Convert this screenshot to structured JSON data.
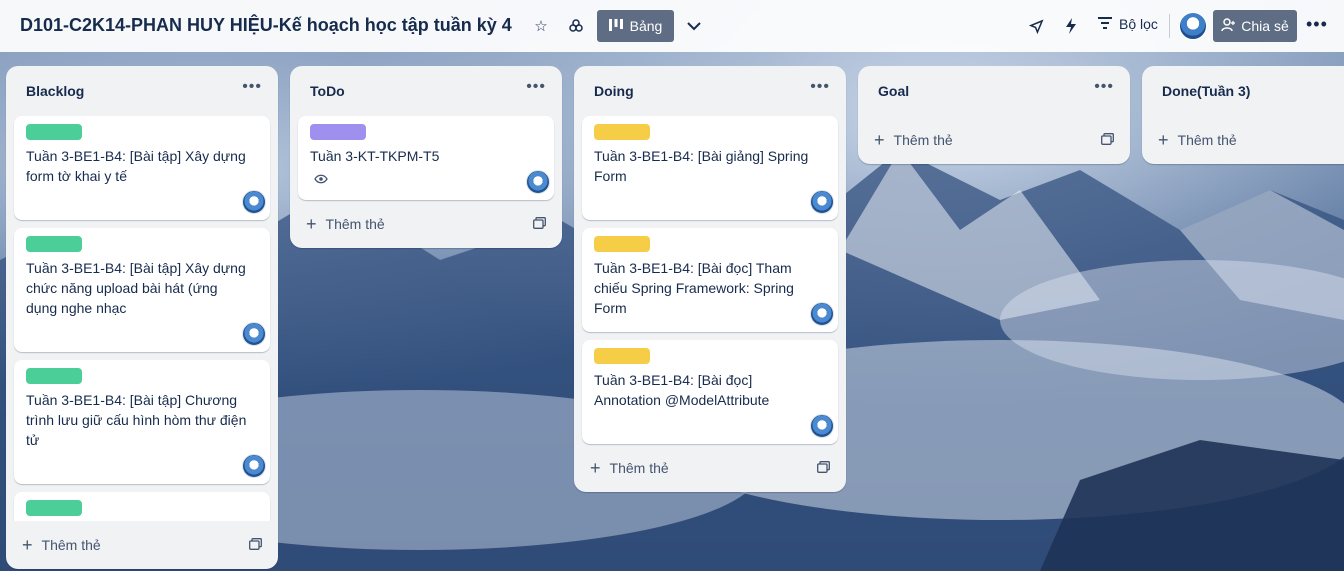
{
  "header": {
    "board_title": "D101-C2K14-PHAN HUY HIỆU-Kế hoạch học tập tuần kỳ 4",
    "view_label": "Bảng",
    "filter_label": "Bộ lọc",
    "share_label": "Chia sẻ",
    "icons": [
      "star-icon",
      "visibility-icon",
      "table-view-icon",
      "chevron-down-icon",
      "rocket-icon",
      "lightning-icon",
      "filter-icon",
      "share-user-icon",
      "more-icon"
    ]
  },
  "lists": {
    "blacklog": {
      "title": "Blacklog",
      "cards": [
        {
          "label_color": "#4bce97",
          "title": "Tuần 3-BE1-B4: [Bài tập] Xây dựng form tờ khai y tế"
        },
        {
          "label_color": "#4bce97",
          "title": "Tuần 3-BE1-B4: [Bài tập] Xây dựng chức năng upload bài hát (ứng dụng nghe nhạc"
        },
        {
          "label_color": "#4bce97",
          "title": "Tuần 3-BE1-B4: [Bài tập] Chương trình lưu giữ cấu hình hòm thư điện tử"
        },
        {
          "label_color": "#4bce97",
          "title": ""
        }
      ],
      "add_label": "Thêm thẻ"
    },
    "todo": {
      "title": "ToDo",
      "cards": [
        {
          "label_color": "#9f8fef",
          "title": "Tuần 3-KT-TKPM-T5"
        }
      ],
      "add_label": "Thêm thẻ"
    },
    "doing": {
      "title": "Doing",
      "cards": [
        {
          "label_color": "#f5cd47",
          "title": "Tuần 3-BE1-B4: [Bài giảng] Spring Form"
        },
        {
          "label_color": "#f5cd47",
          "title": "Tuần 3-BE1-B4: [Bài đọc] Tham chiếu Spring Framework: Spring Form"
        },
        {
          "label_color": "#f5cd47",
          "title": "Tuần 3-BE1-B4: [Bài đọc] Annotation @ModelAttribute"
        }
      ],
      "add_label": "Thêm thẻ"
    },
    "goal": {
      "title": "Goal",
      "cards": [],
      "add_label": "Thêm thẻ"
    },
    "done": {
      "title": "Done(Tuần 3)",
      "cards": [],
      "add_label": "Thêm thẻ"
    }
  }
}
